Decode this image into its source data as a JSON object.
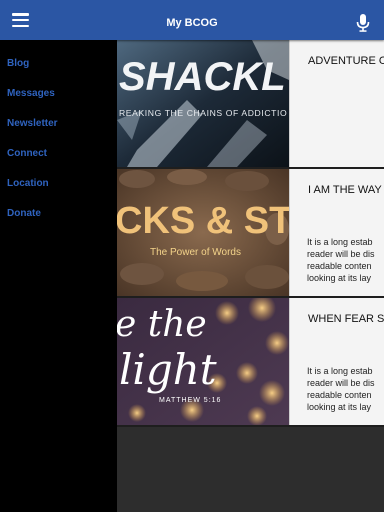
{
  "header": {
    "title": "My BCOG"
  },
  "sidebar": {
    "items": [
      "Blog",
      "Messages",
      "Newsletter",
      "Connect",
      "Location",
      "Donate"
    ]
  },
  "posts": [
    {
      "title": "ADVENTURE O",
      "image": {
        "headline": "SHACKL",
        "tagline": "REAKING THE CHAINS OF ADDICTIO"
      },
      "excerpt": []
    },
    {
      "title": "I AM THE WAY",
      "image": {
        "headline": "CKS & STO",
        "tagline": "The Power of Words"
      },
      "excerpt": [
        "It is a long estab",
        "reader will be dis",
        "readable conten",
        "looking at its lay"
      ]
    },
    {
      "title": "WHEN FEAR S",
      "image": {
        "headline_1": "e the",
        "headline_2": "light",
        "tagline": "MATTHEW 5:16"
      },
      "excerpt": [
        "It is a long estab",
        "reader will be dis",
        "readable conten",
        "looking at its lay"
      ]
    }
  ],
  "colors": {
    "header_bg": "#2b56a4",
    "sidebar_bg": "#000000",
    "sidebar_link": "#2f63bf",
    "card_bg": "#f4f4f4"
  }
}
